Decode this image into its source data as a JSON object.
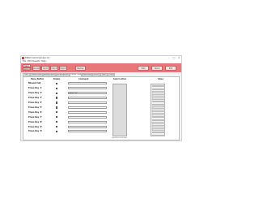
{
  "window": {
    "title": "MIDI Commander.ini"
  },
  "menubar": {
    "items": [
      "File",
      "Edit",
      "Presets",
      "Help"
    ]
  },
  "toolbar": {
    "buttons": [
      {
        "name": "save-button",
        "label": "Save"
      },
      {
        "name": "reload-button",
        "label": "Reload"
      },
      {
        "name": "connect-button",
        "label": "Connect"
      },
      {
        "name": "send-button",
        "label": "Send"
      },
      {
        "name": "import-button",
        "label": "Import"
      },
      {
        "name": "export-button",
        "label": "Export"
      },
      {
        "name": "backup-button",
        "label": "Backup"
      },
      {
        "name": "help-button",
        "label": "Help"
      },
      {
        "name": "about-button",
        "label": "About"
      },
      {
        "name": "exit-button",
        "label": "Exit"
      }
    ]
  },
  "tabs": [
    "Main",
    "Global Pedals",
    "Analog Inputs",
    "Pot Assignment",
    "Control Cmds",
    "Expression",
    "Presets",
    "Sysex",
    "Config"
  ],
  "active_tab": 4,
  "table": {
    "headers": {
      "name": "Name Button",
      "enable": "Enable",
      "command": "Command",
      "select": "Select action",
      "value": "Value"
    },
    "rows": [
      {
        "label": "Missed Call",
        "command": ""
      },
      {
        "label": "Press Key '1'",
        "command": ""
      },
      {
        "label": "Press Key '2'",
        "command": "press 1+2"
      },
      {
        "label": "Press Key '3'",
        "command": ""
      },
      {
        "label": "Press Key '4'",
        "command": ""
      },
      {
        "label": "Press Key '5'",
        "command": ""
      },
      {
        "label": "Press Key '6'",
        "command": ""
      },
      {
        "label": "Press Key '7'",
        "command": ""
      },
      {
        "label": "Press Key '8'",
        "command": ""
      },
      {
        "label": "Press Key '9'",
        "command": ""
      },
      {
        "label": "Press Key '0'",
        "command": ""
      }
    ]
  },
  "footnote": "Log all events below",
  "colors": {
    "toolbar": "#e7787a",
    "outer_frame": "#eea0a0"
  }
}
